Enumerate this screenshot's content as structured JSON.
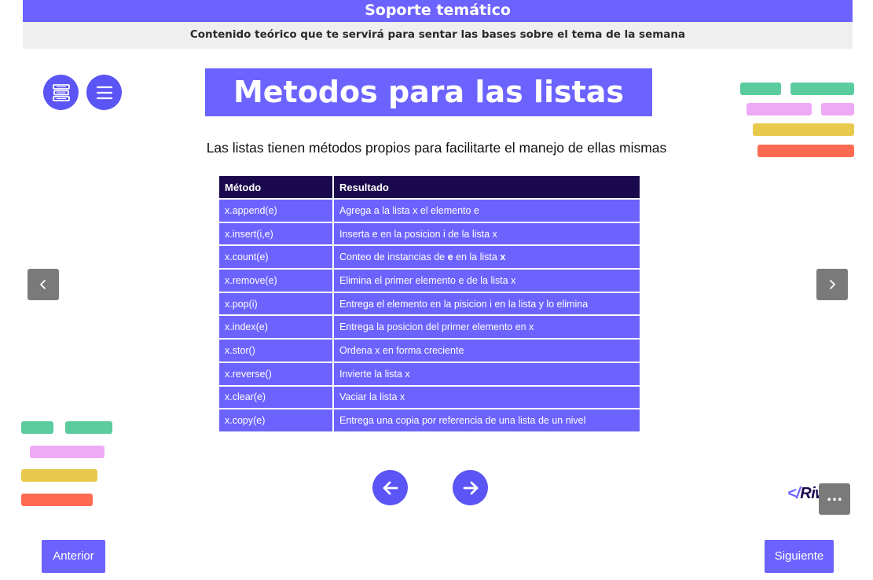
{
  "header": {
    "title": "Soporte temático",
    "subtitle": "Contenido teórico que te servirá para sentar las bases sobre el tema de la semana"
  },
  "toolbar": {
    "books_icon": "books-icon",
    "menu_icon": "menu-icon"
  },
  "main": {
    "title": "Metodos para las listas",
    "intro": "Las listas tienen métodos propios para facilitarte el manejo de ellas mismas"
  },
  "table": {
    "headers": [
      "Método",
      "Resultado"
    ],
    "rows": [
      {
        "method": "x.append(e)",
        "result": "Agrega a la lista x el elemento e"
      },
      {
        "method": "x.insert(i,e)",
        "result": "Inserta e en la posicion i de la lista x"
      },
      {
        "method": "x.count(e)",
        "result_parts": [
          "Conteo de instancias de ",
          "e",
          " en la lista ",
          "x"
        ]
      },
      {
        "method": "x.remove(e)",
        "result": "Elimina el primer elemento e de la lista x"
      },
      {
        "method": "x.pop(i)",
        "result": "Entrega el elemento en la pisicion i en la lista y lo elimina"
      },
      {
        "method": "x.index(e)",
        "result": "Entrega la posicion del primer elemento en x"
      },
      {
        "method": "x.stor()",
        "result": "Ordena x en forma creciente"
      },
      {
        "method": "x.reverse()",
        "result": "Invierte la lista x"
      },
      {
        "method": "x.clear(e)",
        "result": "Vaciar la lista x"
      },
      {
        "method": "x.copy(e)",
        "result": "Entrega una copia por referencia de una lista de un nivel"
      }
    ]
  },
  "navigation": {
    "prev_arrow": "‹",
    "next_arrow": "›",
    "back_icon": "arrow-left-icon",
    "forward_icon": "arrow-right-icon",
    "prev_label": "Anterior",
    "next_label": "Siguiente",
    "more_label": "..."
  },
  "logo": {
    "open": "</",
    "word": "Riwi",
    "close": ">"
  },
  "colors": {
    "primary": "#6c63ff",
    "dark": "#1a0a4d",
    "green": "#5acc9e",
    "pink": "#eeaaf5",
    "yellow": "#e8c94c",
    "red": "#ff6b52"
  }
}
